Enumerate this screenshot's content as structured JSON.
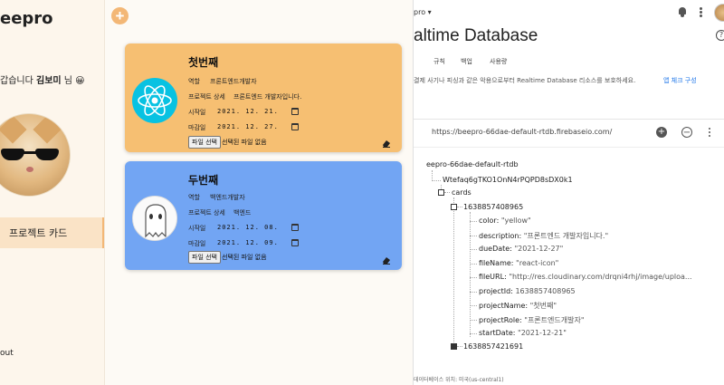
{
  "app": {
    "brand": "eepro",
    "greeting_prefix": "갑습니다",
    "user_name": "김보미",
    "greeting_suffix": "님 😀",
    "nav_active": "프로젝트 카드",
    "logout": "out",
    "add_button": "+"
  },
  "cards": [
    {
      "title": "첫번째",
      "color": "#f6bf72",
      "role_label": "역할",
      "role_value": "프론트엔드개발자",
      "detail_label": "프로젝트 상세",
      "detail_value": "프론트엔드 개발자입니다.",
      "start_label": "시작일",
      "start_value": "2021. 12. 21.",
      "due_label": "마감일",
      "due_value": "2021. 12. 27.",
      "file_button": "파일 선택",
      "file_status": "선택된 파일 없음",
      "icon": "react-icon"
    },
    {
      "title": "두번째",
      "color": "#72a5f3",
      "role_label": "역할",
      "role_value": "백엔드개발자",
      "detail_label": "프로젝트 상세",
      "detail_value": "백엔드",
      "start_label": "시작일",
      "start_value": "2021. 12. 08.",
      "due_label": "마감일",
      "due_value": "2021. 12. 09.",
      "file_button": "파일 선택",
      "file_status": "선택된 파일 없음",
      "icon": "ghost-icon"
    }
  ],
  "firebase": {
    "project_selector": "pro ▾",
    "title": "altime Database",
    "help": "?",
    "tabs": [
      "규칙",
      "백업",
      "사용량"
    ],
    "security_banner": "결제 사기나 피싱과 같은 악용으로부터 Realtime Database 리소스를 보호하세요.",
    "security_link": "앱 체크 구성",
    "db_url": "https://beepro-66dae-default-rtdb.firebaseio.com/",
    "tree": {
      "root": "eepro-66dae-default-rtdb",
      "user_key": "Wtefaq6gTKO1OnN4rPQPD8sDX0k1",
      "cards_key": "cards",
      "card_id_1": "1638857408965",
      "fields": [
        {
          "key": "color",
          "value": "\"yellow\""
        },
        {
          "key": "description",
          "value": "\"프론트엔드 개발자입니다.\""
        },
        {
          "key": "dueDate",
          "value": "\"2021-12-27\""
        },
        {
          "key": "fileName",
          "value": "\"react-icon\""
        },
        {
          "key": "fileURL",
          "value": "\"http://res.cloudinary.com/drqni4rhj/image/uploa..."
        },
        {
          "key": "projectId",
          "value": "1638857408965"
        },
        {
          "key": "projectName",
          "value": "\"첫번째\""
        },
        {
          "key": "projectRole",
          "value": "\"프론트엔드개발자\""
        },
        {
          "key": "startDate",
          "value": "\"2021-12-21\""
        }
      ],
      "card_id_2": "1638857421691"
    },
    "footer": "데이터베이스 위치: 미국(us-central1)"
  }
}
